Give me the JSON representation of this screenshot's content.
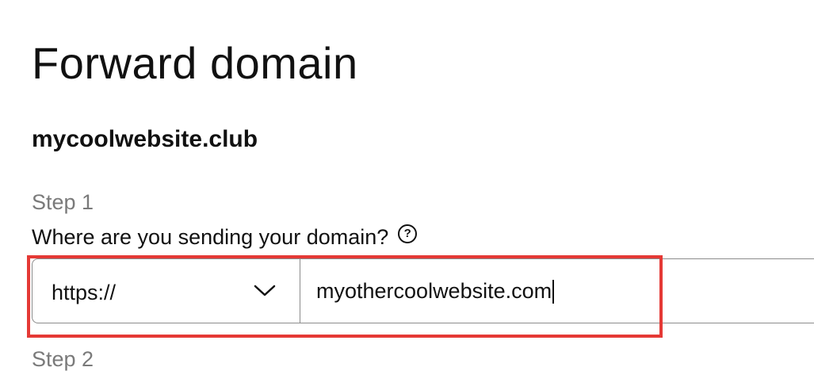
{
  "page": {
    "title": "Forward domain",
    "domain_name": "mycoolwebsite.club"
  },
  "step1": {
    "label": "Step 1",
    "question": "Where are you sending your domain?",
    "help_icon": "question-circle-icon",
    "help_glyph": "?",
    "protocol_selected": "https://",
    "url_value": "myothercoolwebsite.com"
  },
  "step2": {
    "label": "Step 2"
  },
  "colors": {
    "highlight": "#e53935",
    "muted_text": "#7a7a7a",
    "border": "#8c8c8c"
  }
}
